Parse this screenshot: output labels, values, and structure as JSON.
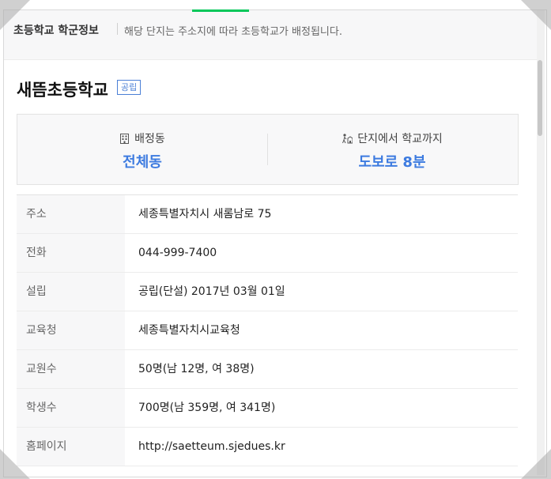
{
  "header": {
    "title": "초등학교 학군정보",
    "description": "해당 단지는 주소지에 따라 초등학교가 배정됩니다."
  },
  "school": {
    "name": "새뜸초등학교",
    "type_badge": "공립"
  },
  "summary": {
    "assigned_area_label": "배정동",
    "assigned_area_value": "전체동",
    "distance_label": "단지에서 학교까지",
    "distance_value": "도보로 8분"
  },
  "details": [
    {
      "label": "주소",
      "value": "세종특별자치시 새롬남로 75"
    },
    {
      "label": "전화",
      "value": "044-999-7400"
    },
    {
      "label": "설립",
      "value": "공립(단설) 2017년 03월 01일"
    },
    {
      "label": "교육청",
      "value": "세종특별자치시교육청"
    },
    {
      "label": "교원수",
      "value": "50명(남 12명, 여 38명)"
    },
    {
      "label": "학생수",
      "value": "700명(남 359명, 여 341명)"
    },
    {
      "label": "홈페이지",
      "value": "http://saetteum.sjedues.kr"
    }
  ],
  "colors": {
    "accent_blue": "#3d7be0",
    "tab_green": "#03c75a"
  },
  "icons": {
    "assigned_area": "building-icon",
    "distance": "walking-school-icon"
  }
}
